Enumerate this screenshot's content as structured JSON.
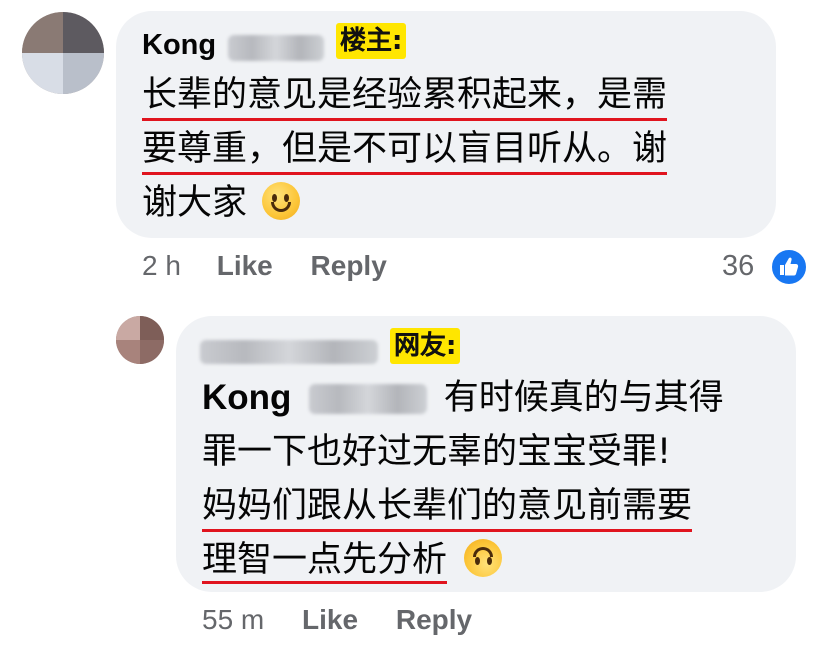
{
  "comment1": {
    "author_first": "Kong",
    "tag": "楼主:",
    "lines": [
      "长辈的意见是经验累积起来，是需",
      "要尊重，但是不可以盲目听从。谢",
      "谢大家"
    ],
    "time": "2 h",
    "like_label": "Like",
    "reply_label": "Reply",
    "reaction_count": "36",
    "reaction_icon": "thumbs-up-icon",
    "emoji": "smiling-face-icon"
  },
  "comment2": {
    "tag": "网友:",
    "mention_first": "Kong",
    "lines": [
      "有时候真的与其得",
      "罪一下也好过无辜的宝宝受罪!",
      "妈妈们跟从长辈们的意见前需要",
      "理智一点先分析"
    ],
    "time": "55 m",
    "like_label": "Like",
    "reply_label": "Reply",
    "emoji": "upside-down-face-icon"
  },
  "colors": {
    "bubble": "#f0f2f5",
    "underline": "#e0141e",
    "tag_highlight": "#ffe600",
    "meta_text": "#65676b",
    "like_blue": "#1877f2"
  }
}
